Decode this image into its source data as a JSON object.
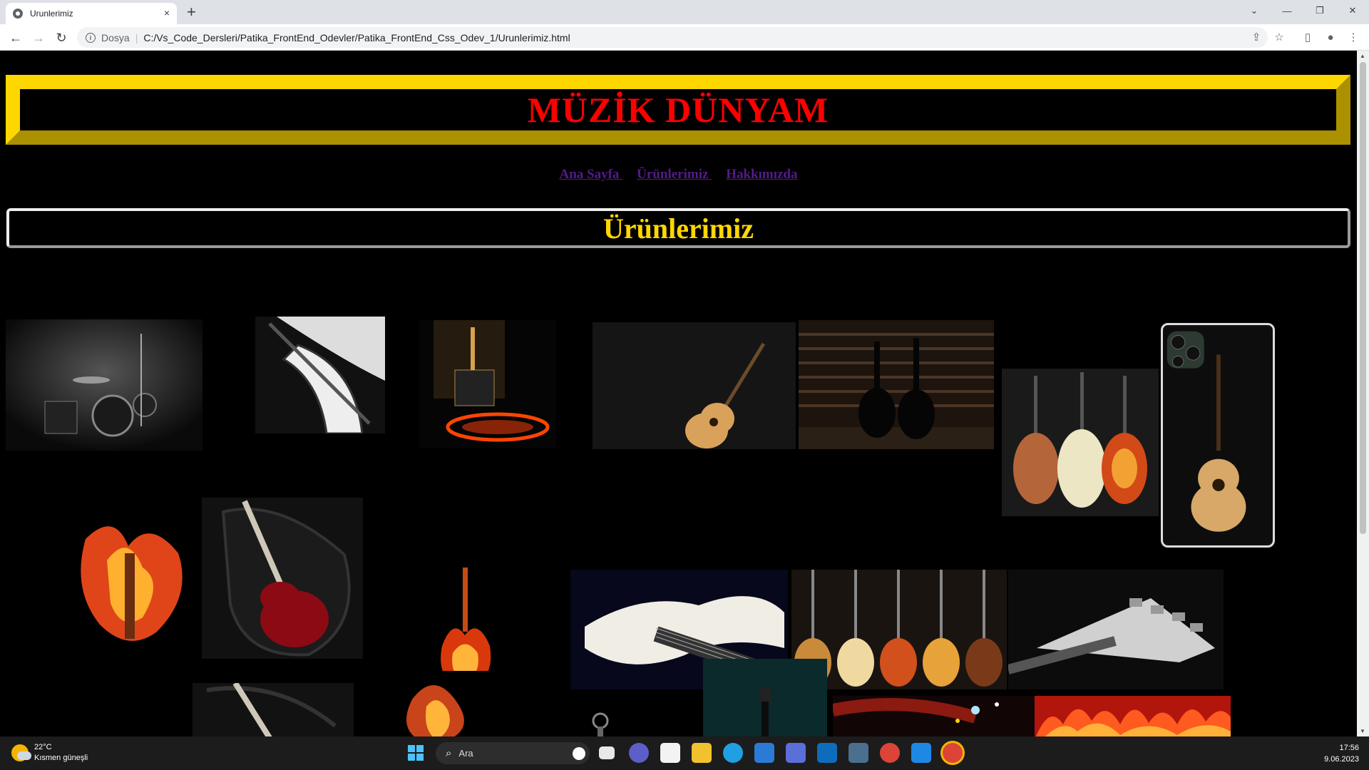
{
  "browser": {
    "tab_title": "Urunlerimiz",
    "tab_close": "×",
    "new_tab": "+",
    "address_scheme": "Dosya",
    "address_separator": "|",
    "address_url": "C:/Vs_Code_Dersleri/Patika_FrontEnd_Odevler/Patika_FrontEnd_Css_Odev_1/Urunlerimiz.html",
    "back_glyph": "←",
    "forward_glyph": "→",
    "reload_glyph": "↻",
    "info_glyph": "i",
    "share_glyph": "⇪",
    "star_glyph": "☆",
    "sidepanel_glyph": "▯",
    "profile_glyph": "●",
    "menu_glyph": "⋮",
    "tabs_dropdown_glyph": "⌄",
    "minimize_glyph": "—",
    "restore_glyph": "❐",
    "close_glyph": "✕"
  },
  "page": {
    "header_title": "MÜZİK DÜNYAM",
    "nav": [
      {
        "label": "Ana Sayfa "
      },
      {
        "label": "Ürünlerimiz "
      },
      {
        "label": "Hakkımızda"
      }
    ],
    "section_title": "Ürünlerimiz",
    "colors": {
      "header_border": "#ffd700",
      "header_text": "#ff0000",
      "nav_link": "#551a8b",
      "section_text": "#ffd700",
      "background": "#000000"
    },
    "images": [
      {
        "name": "drum-kit-stage-image"
      },
      {
        "name": "electric-guitar-closeup-image"
      },
      {
        "name": "guitar-amp-fire-image"
      },
      {
        "name": "acoustic-guitar-dark-image"
      },
      {
        "name": "guitar-silhouettes-image"
      },
      {
        "name": "three-acoustic-guitars-image"
      },
      {
        "name": "phone-case-guitar-image"
      },
      {
        "name": "flaming-guitar-headstock-image"
      },
      {
        "name": "red-guitar-in-case-image"
      },
      {
        "name": "burning-guitar-image"
      },
      {
        "name": "electric-guitar-fretboard-image"
      },
      {
        "name": "guitar-wall-display-image"
      },
      {
        "name": "silver-guitar-headstock-image"
      },
      {
        "name": "guitar-in-case-image"
      },
      {
        "name": "smoky-fire-guitar-image"
      },
      {
        "name": "dark-violin-scroll-image"
      },
      {
        "name": "teal-guitar-neck-image"
      },
      {
        "name": "guitar-sparks-image"
      },
      {
        "name": "red-flames-image"
      }
    ]
  },
  "taskbar": {
    "weather_temp": "22°C",
    "weather_desc": "Kısmen güneşli",
    "search_label": "Ara",
    "search_glyph": "⌕",
    "time": "17:56",
    "date": "9.06.2023"
  }
}
